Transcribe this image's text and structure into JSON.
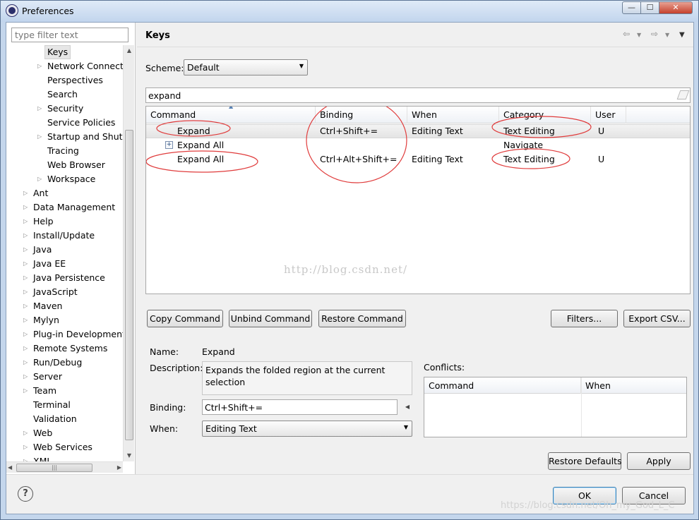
{
  "window": {
    "title": "Preferences",
    "min_glyph": "—",
    "max_glyph": "☐",
    "close_glyph": "✕"
  },
  "filter": {
    "placeholder": "type filter text"
  },
  "tree": {
    "items": [
      {
        "label": "Keys",
        "selected": true
      },
      {
        "label": "Network Connecti",
        "expandable": true
      },
      {
        "label": "Perspectives"
      },
      {
        "label": "Search"
      },
      {
        "label": "Security",
        "expandable": true
      },
      {
        "label": "Service Policies"
      },
      {
        "label": "Startup and Shutd",
        "expandable": true
      },
      {
        "label": "Tracing"
      },
      {
        "label": "Web Browser"
      },
      {
        "label": "Workspace",
        "expandable": true
      },
      {
        "label": "Ant",
        "expandable": true
      },
      {
        "label": "Data Management",
        "expandable": true
      },
      {
        "label": "Help",
        "expandable": true
      },
      {
        "label": "Install/Update",
        "expandable": true
      },
      {
        "label": "Java",
        "expandable": true
      },
      {
        "label": "Java EE",
        "expandable": true
      },
      {
        "label": "Java Persistence",
        "expandable": true
      },
      {
        "label": "JavaScript",
        "expandable": true
      },
      {
        "label": "Maven",
        "expandable": true
      },
      {
        "label": "Mylyn",
        "expandable": true
      },
      {
        "label": "Plug-in Development",
        "expandable": true
      },
      {
        "label": "Remote Systems",
        "expandable": true
      },
      {
        "label": "Run/Debug",
        "expandable": true
      },
      {
        "label": "Server",
        "expandable": true
      },
      {
        "label": "Team",
        "expandable": true
      },
      {
        "label": "Terminal"
      },
      {
        "label": "Validation"
      },
      {
        "label": "Web",
        "expandable": true
      },
      {
        "label": "Web Services",
        "expandable": true
      },
      {
        "label": "XML",
        "expandable": true
      }
    ]
  },
  "page": {
    "title": "Keys",
    "back_icon": "⇦",
    "forward_icon": "⇨",
    "menu_icon": "▼"
  },
  "scheme": {
    "label": "Scheme:",
    "value": "Default"
  },
  "search": {
    "value": "expand"
  },
  "table": {
    "headers": [
      "Command",
      "Binding",
      "When",
      "Category",
      "User"
    ],
    "rows": [
      {
        "command": "Expand",
        "binding": "Ctrl+Shift+=",
        "when": "Editing Text",
        "category": "Text Editing",
        "user": "U",
        "selected": true
      },
      {
        "command": "Expand All",
        "binding": "",
        "when": "",
        "category": "Navigate",
        "user": "",
        "has_plus": true
      },
      {
        "command": "Expand All",
        "binding": "Ctrl+Alt+Shift+=",
        "when": "Editing Text",
        "category": "Text Editing",
        "user": "U"
      }
    ],
    "watermark": "http://blog.csdn.net/"
  },
  "actions": {
    "copy": "Copy Command",
    "unbind": "Unbind Command",
    "restore": "Restore Command",
    "filters": "Filters...",
    "export": "Export CSV..."
  },
  "details": {
    "name_label": "Name:",
    "name_value": "Expand",
    "description_label": "Description:",
    "description_value": "Expands the folded region at the current selection",
    "binding_label": "Binding:",
    "binding_value": "Ctrl+Shift+=",
    "when_label": "When:",
    "when_value": "Editing Text"
  },
  "conflicts": {
    "label": "Conflicts:",
    "headers": [
      "Command",
      "When"
    ]
  },
  "footer": {
    "restore_defaults": "Restore Defaults",
    "apply": "Apply",
    "ok": "OK",
    "cancel": "Cancel",
    "help": "?",
    "watermark": "https://blog.csdn.net/Oh_my_God_L_C"
  },
  "annotations": {
    "circle_color": "#e03c3c"
  }
}
